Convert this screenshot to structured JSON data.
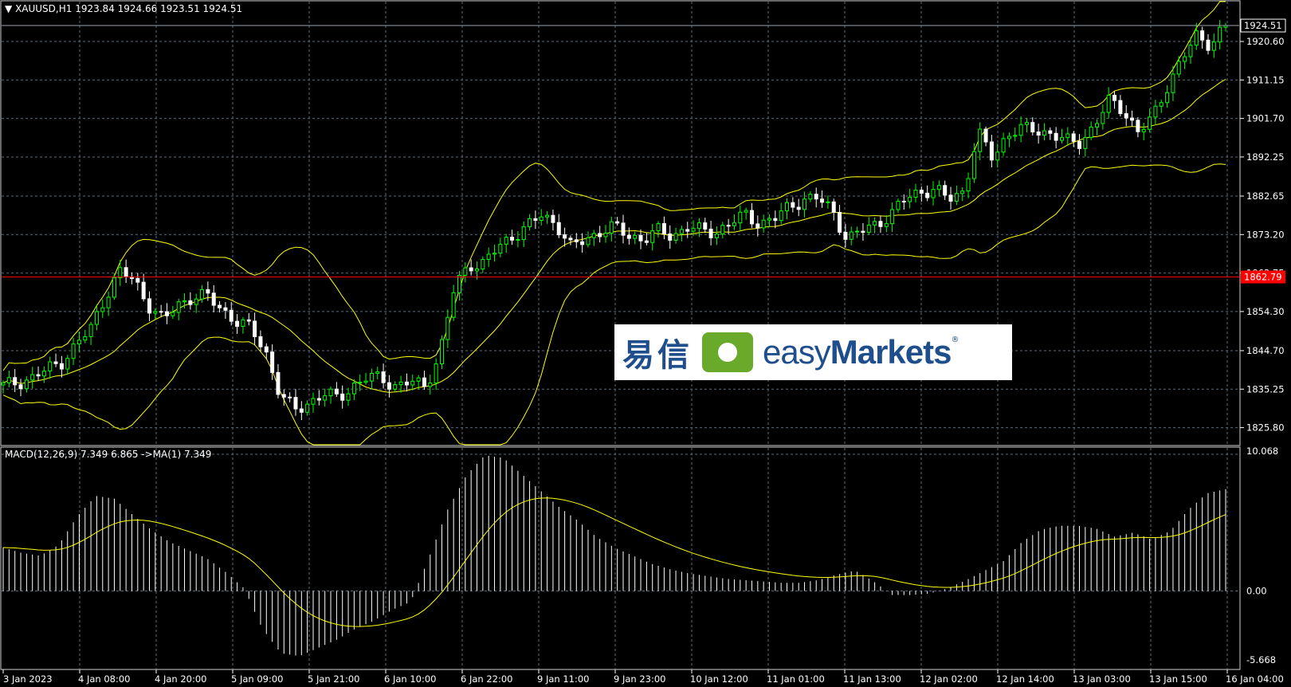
{
  "header": {
    "symbol_line": "XAUUSD,H1  1923.84 1924.66 1923.51 1924.51",
    "macd_line": "MACD(12,26,9) 7.349 6.865  ->MA(1) 7.349"
  },
  "price_axis": {
    "current_price": "1924.51",
    "level_price": "1862.79",
    "ticks": [
      "1920.60",
      "1911.15",
      "1901.70",
      "1892.25",
      "1882.65",
      "1873.20",
      "1863.75",
      "1854.30",
      "1844.70",
      "1835.25",
      "1825.80"
    ]
  },
  "macd_axis": {
    "ticks": [
      "10.068",
      "0.00",
      "-5.668"
    ]
  },
  "time_axis": {
    "ticks": [
      "3 Jan 2023",
      "4 Jan 08:00",
      "4 Jan 20:00",
      "5 Jan 09:00",
      "5 Jan 21:00",
      "6 Jan 10:00",
      "6 Jan 22:00",
      "9 Jan 11:00",
      "9 Jan 23:00",
      "10 Jan 12:00",
      "11 Jan 01:00",
      "11 Jan 13:00",
      "12 Jan 02:00",
      "12 Jan 14:00",
      "13 Jan 03:00",
      "13 Jan 15:00",
      "16 Jan 04:00"
    ]
  },
  "logo": {
    "cn_text": "易信",
    "en_text_light": "easy",
    "en_text_bold": "Markets",
    "reg_mark": "®"
  },
  "colors": {
    "background": "#000000",
    "bull": "#00ff00",
    "bear": "#ffffff",
    "bands": "#ffff00",
    "level_line": "#ff0000",
    "grid": "#5a6a7a"
  },
  "chart_data": [
    {
      "type": "candlestick",
      "title": "XAUUSD,H1",
      "ylim": [
        1822,
        1930
      ],
      "level_line": 1862.79,
      "close_path": [
        1836,
        1837,
        1838,
        1840,
        1842,
        1846,
        1850,
        1858,
        1864,
        1862,
        1856,
        1852,
        1856,
        1858,
        1858,
        1855,
        1852,
        1850,
        1845,
        1834,
        1830,
        1832,
        1834,
        1833,
        1836,
        1838,
        1838,
        1836,
        1837,
        1836,
        1844,
        1860,
        1866,
        1866,
        1870,
        1873,
        1875,
        1878,
        1876,
        1870,
        1872,
        1874,
        1875,
        1873,
        1872,
        1874,
        1873,
        1875,
        1874,
        1874,
        1876,
        1878,
        1876,
        1877,
        1880,
        1882,
        1882,
        1879,
        1872,
        1874,
        1876,
        1878,
        1882,
        1884,
        1884,
        1882,
        1884,
        1898,
        1892,
        1898,
        1899,
        1899,
        1898,
        1896,
        1896,
        1900,
        1906,
        1904,
        1898,
        1902,
        1910,
        1916,
        1922,
        1920,
        1924.51
      ],
      "bollinger": {
        "period": 20
      },
      "grid": true
    },
    {
      "type": "histogram",
      "title": "MACD(12,26,9)",
      "ylim": [
        -5.668,
        10.068
      ],
      "macd_path": [
        3.2,
        2.8,
        2.6,
        3.4,
        5.5,
        7.0,
        6.8,
        5.6,
        4.5,
        3.6,
        3.0,
        2.4,
        1.4,
        0.2,
        -2.8,
        -4.6,
        -4.8,
        -4.2,
        -3.6,
        -2.8,
        -2.2,
        -1.4,
        -0.8,
        2.5,
        6.0,
        8.5,
        10.0,
        9.8,
        8.6,
        7.4,
        6.2,
        5.2,
        4.0,
        3.2,
        2.6,
        2.0,
        1.6,
        1.3,
        1.1,
        0.9,
        0.8,
        0.7,
        0.6,
        0.6,
        0.8,
        1.2,
        1.5,
        0.7,
        -0.3,
        -0.3,
        -0.2,
        0.2,
        0.8,
        1.5,
        2.2,
        3.6,
        4.5,
        4.8,
        4.8,
        4.6,
        4.0,
        4.3,
        3.8,
        4.4,
        6.0,
        7.2,
        7.5
      ],
      "signal_ma": 9,
      "grid": true
    }
  ]
}
